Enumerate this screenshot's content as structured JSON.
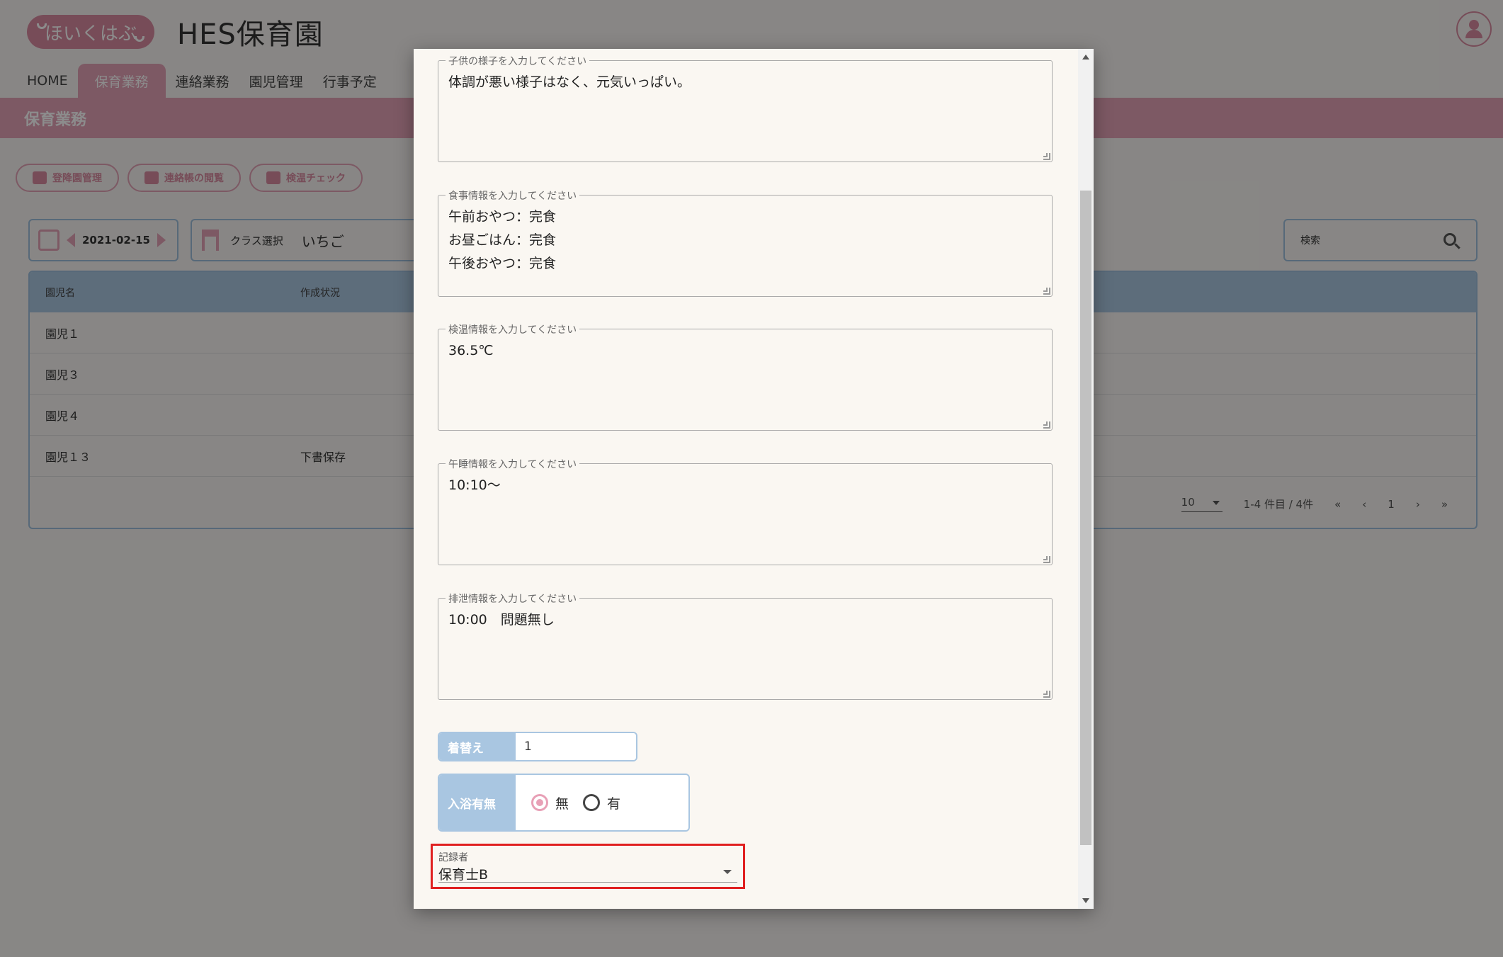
{
  "app": {
    "logo_text": "ほいくはぶ",
    "title": "HES保育園"
  },
  "nav": {
    "items": [
      "HOME",
      "保育業務",
      "連絡業務",
      "園児管理",
      "行事予定"
    ],
    "active": "保育業務"
  },
  "section_title": "保育業務",
  "toolbar": {
    "buttons": [
      "登降園管理",
      "連絡帳の閲覧",
      "検温チェック"
    ]
  },
  "filters": {
    "date": "2021-02-15",
    "class_label": "クラス選択",
    "class_value": "いちご",
    "search_placeholder": "検索"
  },
  "table": {
    "headers": [
      "園児名",
      "作成状況"
    ],
    "rows": [
      [
        "園児１",
        ""
      ],
      [
        "園児３",
        ""
      ],
      [
        "園児４",
        ""
      ],
      [
        "園児１３",
        "下書保存"
      ]
    ],
    "per_page": "10",
    "range": "1-4 件目 / 4件",
    "page": "1"
  },
  "modal": {
    "fields": [
      {
        "label": "子供の様子を入力してください",
        "value": "体調が悪い様子はなく、元気いっぱい。"
      },
      {
        "label": "食事情報を入力してください",
        "value": "午前おやつ：完食\nお昼ごはん：完食\n午後おやつ：完食"
      },
      {
        "label": "検温情報を入力してください",
        "value": "36.5℃"
      },
      {
        "label": "午睡情報を入力してください",
        "value": "10:10～"
      },
      {
        "label": "排泄情報を入力してください",
        "value": "10:00　問題無し"
      }
    ],
    "change": {
      "label": "着替え",
      "value": "1"
    },
    "bath": {
      "label": "入浴有無",
      "options": [
        "無",
        "有"
      ],
      "selected": "無"
    },
    "recorder": {
      "label": "記録者",
      "value": "保育士B"
    }
  }
}
